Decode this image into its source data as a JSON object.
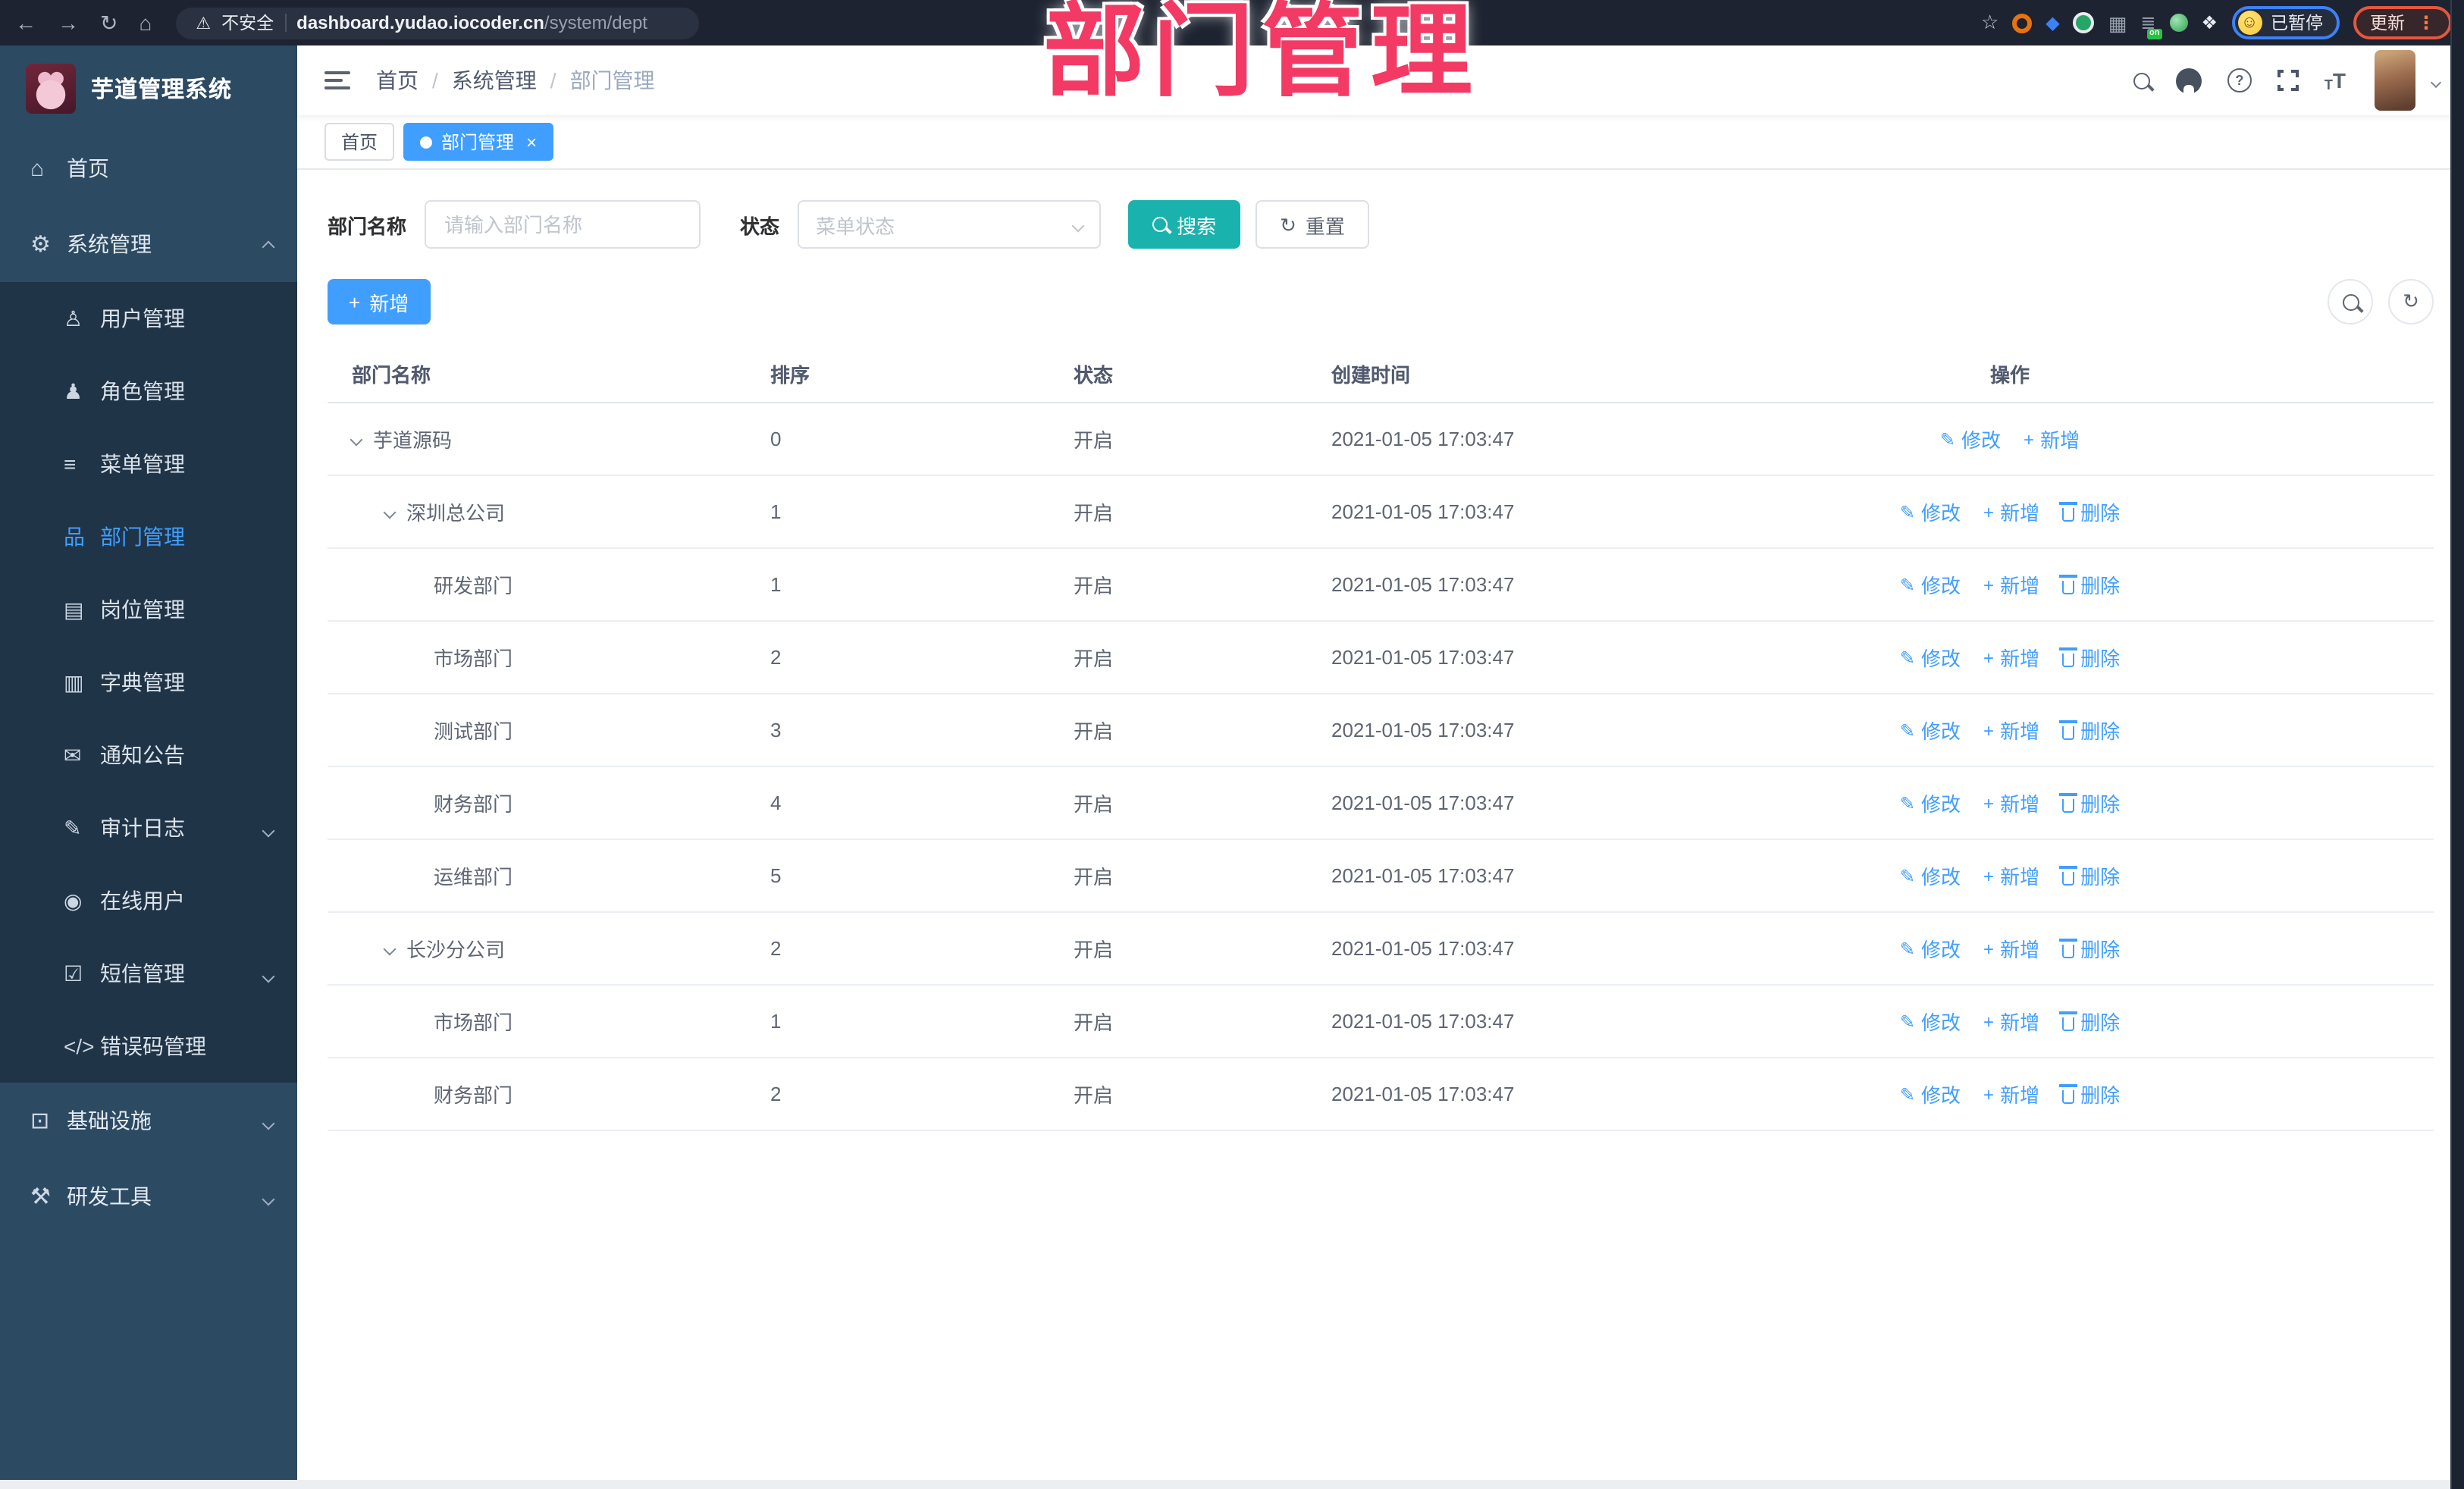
{
  "browser": {
    "security_label": "不安全",
    "url_host": "dashboard.yudao.iocoder.cn",
    "url_path": "/system/dept",
    "profile_status": "已暂停",
    "update_label": "更新"
  },
  "watermark": "部门管理",
  "icons": {
    "back": "←",
    "forward": "→",
    "reload": "↻",
    "home": "⌂",
    "warning": "⚠",
    "star": "☆",
    "grid": "▦",
    "list": "≣",
    "on_badge": "on",
    "puzzle": "❖",
    "gem": "◆",
    "smile": "☺",
    "dots": "⋮",
    "home_menu": "⌂",
    "gear": "⚙",
    "user": "♙",
    "role": "♟",
    "menu": "≡",
    "dept": "品",
    "post": "▤",
    "dict": "▥",
    "notice": "✉",
    "audit": "✎",
    "online": "◉",
    "sms": "☑",
    "errcode": "</>",
    "infra": "⊡",
    "tools": "⚒",
    "edit": "✎",
    "plus": "+",
    "refresh": "↻",
    "close": "×",
    "font_small": "T",
    "font_big": "T",
    "help": "?"
  },
  "sidebar": {
    "title": "芋道管理系统",
    "top_items": [
      {
        "label": "首页"
      },
      {
        "label": "系统管理"
      }
    ],
    "system_children": [
      {
        "label": "用户管理"
      },
      {
        "label": "角色管理"
      },
      {
        "label": "菜单管理"
      },
      {
        "label": "部门管理",
        "active": true
      },
      {
        "label": "岗位管理"
      },
      {
        "label": "字典管理"
      },
      {
        "label": "通知公告"
      },
      {
        "label": "审计日志"
      },
      {
        "label": "在线用户"
      },
      {
        "label": "短信管理"
      },
      {
        "label": "错误码管理"
      }
    ],
    "bottom_items": [
      {
        "label": "基础设施"
      },
      {
        "label": "研发工具"
      }
    ]
  },
  "header": {
    "breadcrumb": [
      "首页",
      "系统管理",
      "部门管理"
    ]
  },
  "tabs": [
    {
      "label": "首页"
    },
    {
      "label": "部门管理",
      "active": true
    }
  ],
  "filters": {
    "name_label": "部门名称",
    "name_placeholder": "请输入部门名称",
    "name_value": "",
    "status_label": "状态",
    "status_placeholder": "菜单状态",
    "search_label": "搜索",
    "reset_label": "重置"
  },
  "toolbar": {
    "add_label": "新增"
  },
  "table": {
    "columns": [
      "部门名称",
      "排序",
      "状态",
      "创建时间",
      "操作"
    ],
    "rows": [
      {
        "name": "芋道源码",
        "sort": "0",
        "status": "开启",
        "created": "2021-01-05 17:03:47",
        "actions": [
          "修改",
          "新增"
        ]
      },
      {
        "name": "深圳总公司",
        "sort": "1",
        "status": "开启",
        "created": "2021-01-05 17:03:47",
        "actions": [
          "修改",
          "新增",
          "删除"
        ]
      },
      {
        "name": "研发部门",
        "sort": "1",
        "status": "开启",
        "created": "2021-01-05 17:03:47",
        "actions": [
          "修改",
          "新增",
          "删除"
        ]
      },
      {
        "name": "市场部门",
        "sort": "2",
        "status": "开启",
        "created": "2021-01-05 17:03:47",
        "actions": [
          "修改",
          "新增",
          "删除"
        ]
      },
      {
        "name": "测试部门",
        "sort": "3",
        "status": "开启",
        "created": "2021-01-05 17:03:47",
        "actions": [
          "修改",
          "新增",
          "删除"
        ]
      },
      {
        "name": "财务部门",
        "sort": "4",
        "status": "开启",
        "created": "2021-01-05 17:03:47",
        "actions": [
          "修改",
          "新增",
          "删除"
        ]
      },
      {
        "name": "运维部门",
        "sort": "5",
        "status": "开启",
        "created": "2021-01-05 17:03:47",
        "actions": [
          "修改",
          "新增",
          "删除"
        ]
      },
      {
        "name": "长沙分公司",
        "sort": "2",
        "status": "开启",
        "created": "2021-01-05 17:03:47",
        "actions": [
          "修改",
          "新增",
          "删除"
        ]
      },
      {
        "name": "市场部门",
        "sort": "1",
        "status": "开启",
        "created": "2021-01-05 17:03:47",
        "actions": [
          "修改",
          "新增",
          "删除"
        ]
      },
      {
        "name": "财务部门",
        "sort": "2",
        "status": "开启",
        "created": "2021-01-05 17:03:47",
        "actions": [
          "修改",
          "新增",
          "删除"
        ]
      }
    ]
  }
}
